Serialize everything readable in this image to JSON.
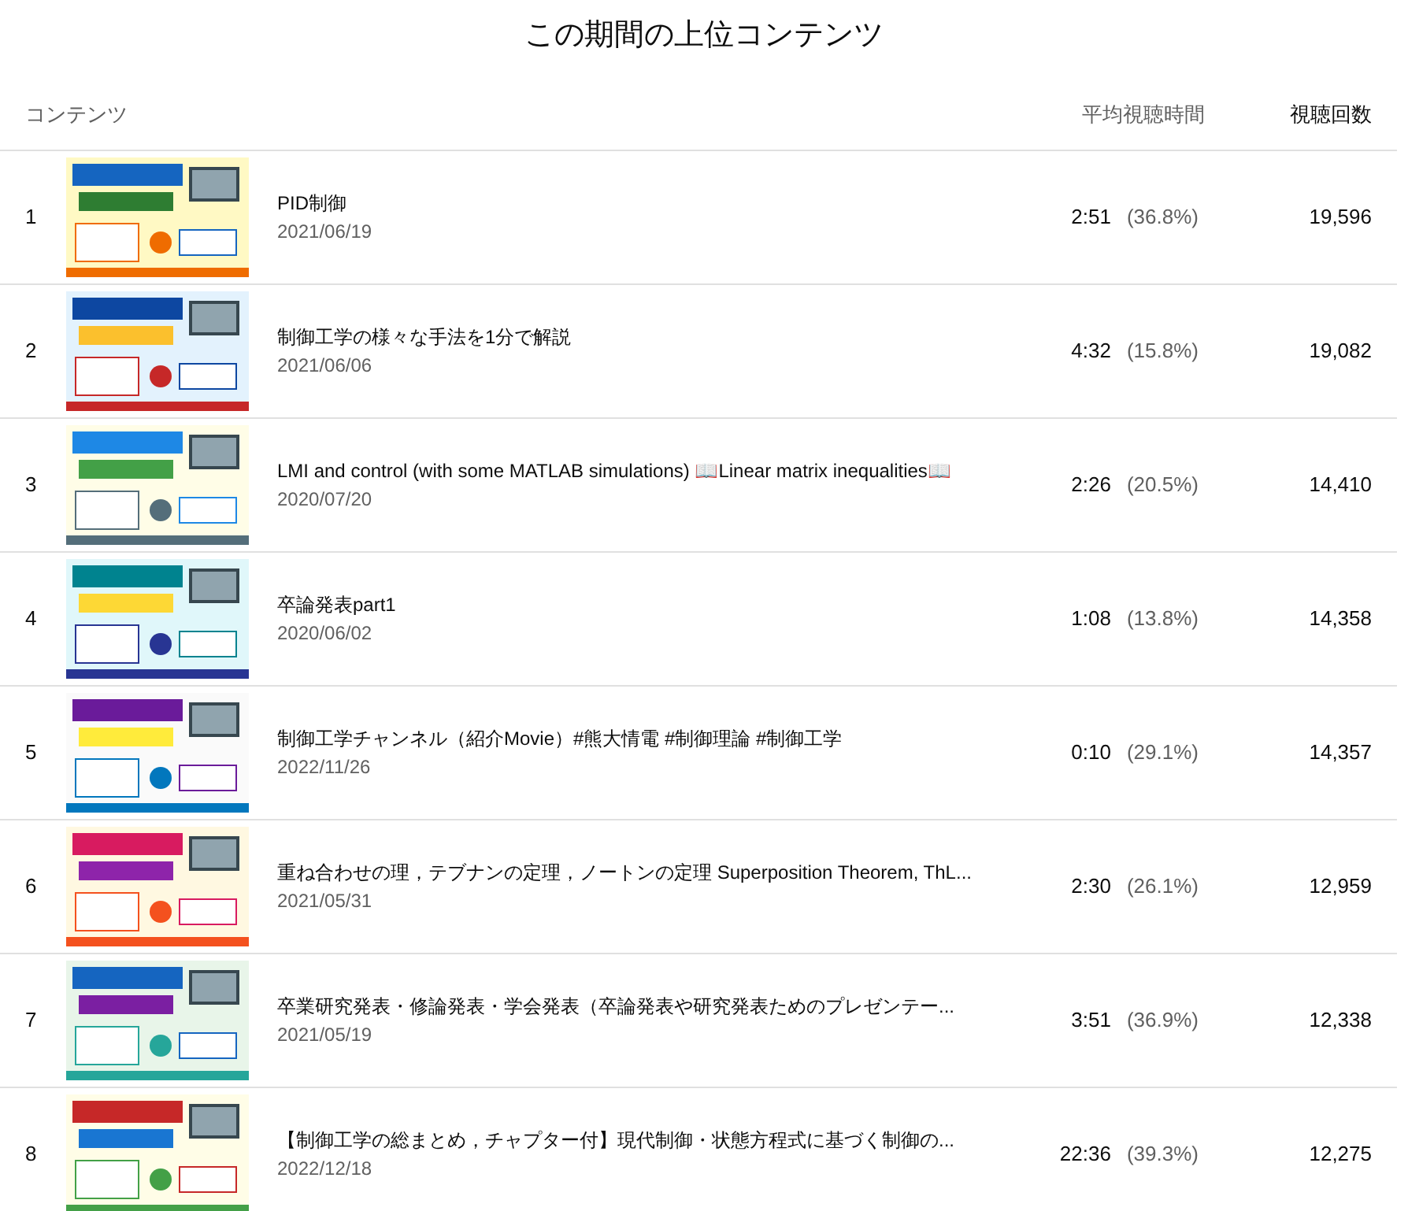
{
  "title": "この期間の上位コンテンツ",
  "columns": {
    "content": "コンテンツ",
    "avg_view_duration": "平均視聴時間",
    "views": "視聴回数"
  },
  "rows": [
    {
      "rank": "1",
      "title": "PID制御",
      "date": "2021/06/19",
      "duration": "2:51",
      "percent": "(36.8%)",
      "views": "19,596"
    },
    {
      "rank": "2",
      "title": "制御工学の様々な手法を1分で解説",
      "date": "2021/06/06",
      "duration": "4:32",
      "percent": "(15.8%)",
      "views": "19,082"
    },
    {
      "rank": "3",
      "title": "LMI and control (with some MATLAB simulations) 📖Linear matrix inequalities📖",
      "date": "2020/07/20",
      "duration": "2:26",
      "percent": "(20.5%)",
      "views": "14,410"
    },
    {
      "rank": "4",
      "title": "卒論発表part1",
      "date": "2020/06/02",
      "duration": "1:08",
      "percent": "(13.8%)",
      "views": "14,358"
    },
    {
      "rank": "5",
      "title": "制御工学チャンネル（紹介Movie）#熊大情電 #制御理論 #制御工学",
      "date": "2022/11/26",
      "duration": "0:10",
      "percent": "(29.1%)",
      "views": "14,357"
    },
    {
      "rank": "6",
      "title": "重ね合わせの理，テブナンの定理，ノートンの定理 Superposition Theorem, ThL...",
      "date": "2021/05/31",
      "duration": "2:30",
      "percent": "(26.1%)",
      "views": "12,959"
    },
    {
      "rank": "7",
      "title": "卒業研究発表・修論発表・学会発表（卒論発表や研究発表ためのプレゼンテー...",
      "date": "2021/05/19",
      "duration": "3:51",
      "percent": "(36.9%)",
      "views": "12,338"
    },
    {
      "rank": "8",
      "title": "【制御工学の総まとめ，チャプター付】現代制御・状態方程式に基づく制御の...",
      "date": "2022/12/18",
      "duration": "22:36",
      "percent": "(39.3%)",
      "views": "12,275"
    }
  ]
}
